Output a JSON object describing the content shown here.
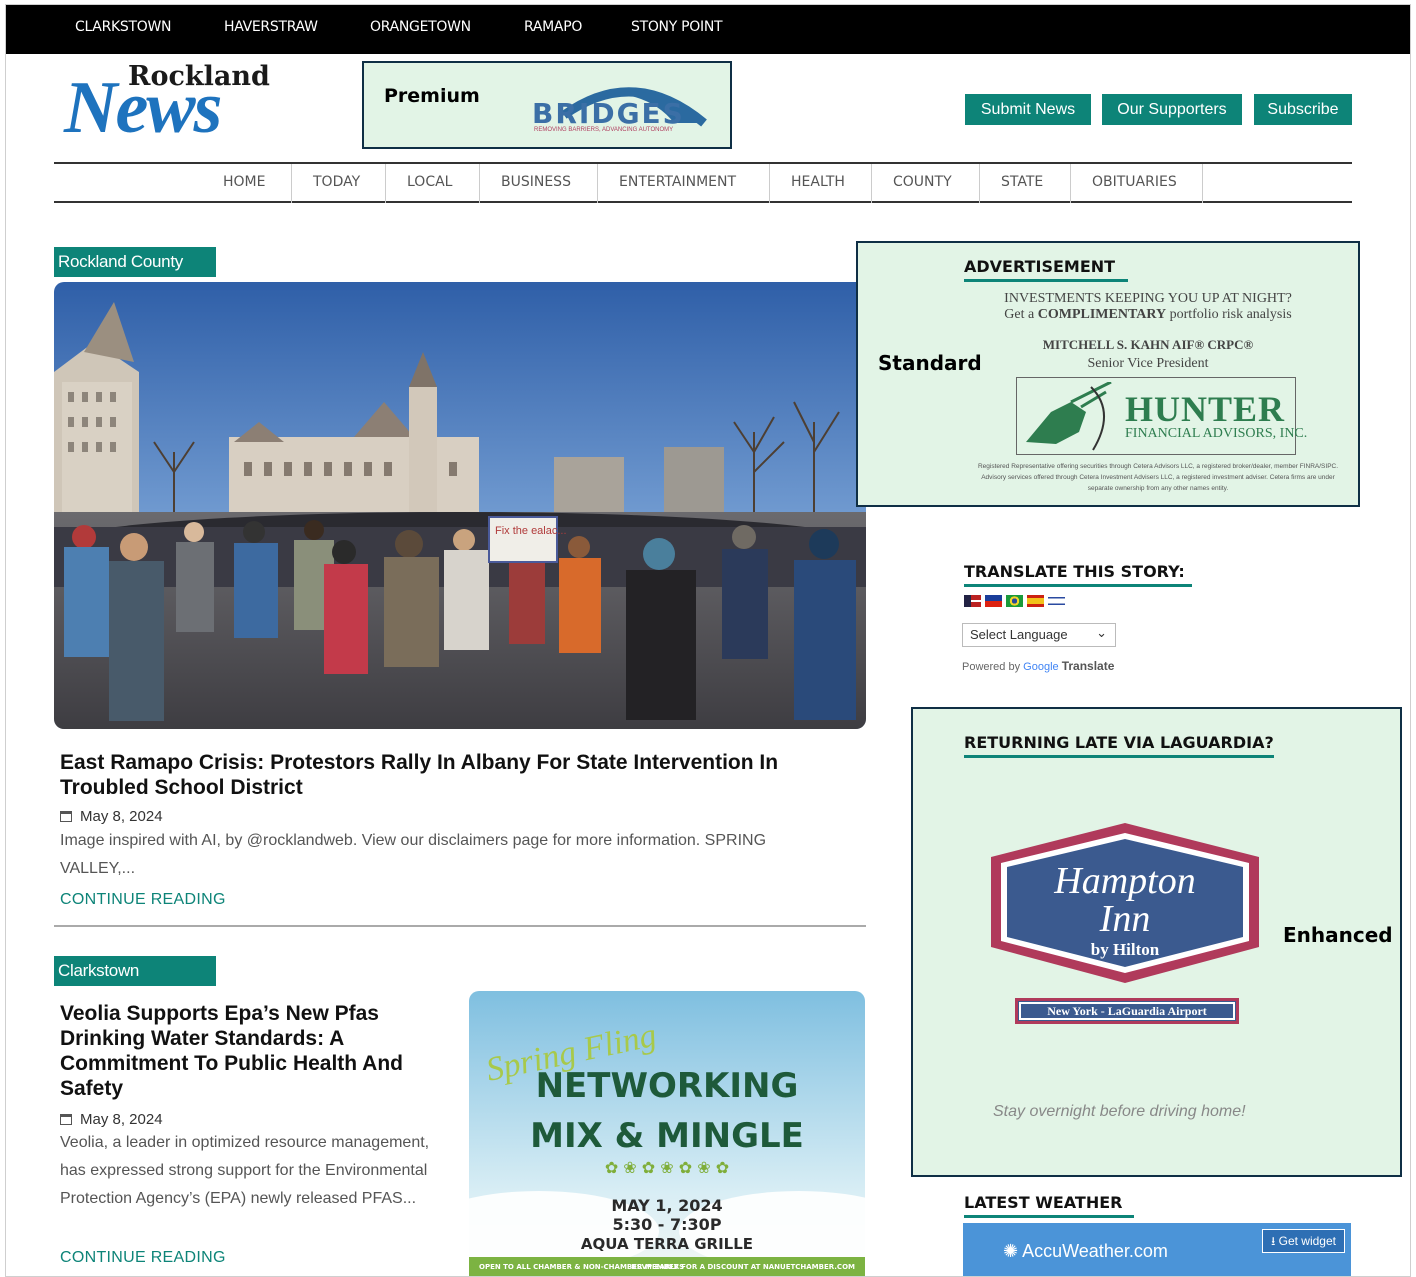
{
  "top_nav": [
    "CLARKSTOWN",
    "HAVERSTRAW",
    "ORANGETOWN",
    "RAMAPO",
    "STONY POINT"
  ],
  "logo": {
    "line1": "Rockland",
    "line2": "News"
  },
  "premium_ad": {
    "label": "Premium",
    "brand": "BRIDGES",
    "tagline": "REMOVING BARRIERS, ADVANCING AUTONOMY"
  },
  "header_buttons": {
    "submit": "Submit News",
    "supporters": "Our Supporters",
    "subscribe": "Subscribe"
  },
  "main_nav": [
    "HOME",
    "TODAY",
    "LOCAL",
    "BUSINESS",
    "ENTERTAINMENT",
    "HEALTH",
    "COUNTY",
    "STATE",
    "OBITUARIES"
  ],
  "articles": [
    {
      "category": "Rockland County",
      "title": "East Ramapo Crisis: Protestors Rally In Albany For State Intervention In Troubled School District",
      "date": "May 8, 2024",
      "excerpt": "Image inspired with AI, by @rocklandweb. View our disclaimers page for more information. SPRING VALLEY,...",
      "cta": "CONTINUE READING",
      "image_sign": "Fix the ealac..."
    },
    {
      "category": "Clarkstown",
      "title": "Veolia Supports Epa’s New Pfas Drinking Water Standards: A Commitment To Public Health And Safety",
      "date": "May 8, 2024",
      "excerpt": "Veolia, a leader in optimized resource management, has expressed strong support for the Environmental Protection Agency’s (EPA) newly released PFAS...",
      "cta": "CONTINUE READING"
    }
  ],
  "networking_image": {
    "script": "Spring Fling",
    "line1": "NETWORKING",
    "line2": "MIX & MINGLE",
    "date": "MAY 1, 2024",
    "time": "5:30 - 7:30P",
    "venue": "AQUA TERRA GRILLE",
    "footer_left": "OPEN TO ALL CHAMBER & NON-CHAMBER MEMBERS",
    "footer_right": "RSVP EARLY FOR A DISCOUNT AT NANUETCHAMBER.COM"
  },
  "standard_ad": {
    "label": "Standard",
    "heading": "ADVERTISEMENT",
    "line1": "INVESTMENTS KEEPING YOU UP AT NIGHT?",
    "line2a": "Get a ",
    "line2b": "COMPLIMENTARY",
    "line2c": " portfolio risk analysis",
    "name": "MITCHELL S. KAHN AIF® CRPC®",
    "role": "Senior Vice President",
    "brand": "HUNTER",
    "brand_sub": "FINANCIAL ADVISORS, INC.",
    "disclaimer": "Registered Representative offering securities through Cetera Advisors LLC, a registered broker/dealer, member FINRA/SIPC. Advisory services offered through Cetera Investment Advisers LLC, a registered investment adviser. Cetera firms are under separate ownership from any other names entity."
  },
  "translate": {
    "heading": "TRANSLATE THIS STORY:",
    "select": "Select Language",
    "powered_by": "Powered by ",
    "google": "Google",
    "translate": "Translate"
  },
  "enhanced_ad": {
    "label": "Enhanced",
    "heading": "RETURNING LATE VIA LAGUARDIA?",
    "brand1": "Hampton",
    "brand2": "Inn",
    "brand3": "by Hilton",
    "location": "New York - LaGuardia Airport",
    "tagline": "Stay overnight before driving home!"
  },
  "weather": {
    "heading": "LATEST WEATHER",
    "brand": "AccuWeather.com",
    "widget": "Get widget"
  },
  "colors": {
    "teal": "#0d8478",
    "ad_bg": "#e2f4e6",
    "ad_border": "#0f2f45",
    "logo_blue": "#1e73be",
    "hampton_blue": "#3b5a8f",
    "hampton_red": "#b03a5b"
  }
}
